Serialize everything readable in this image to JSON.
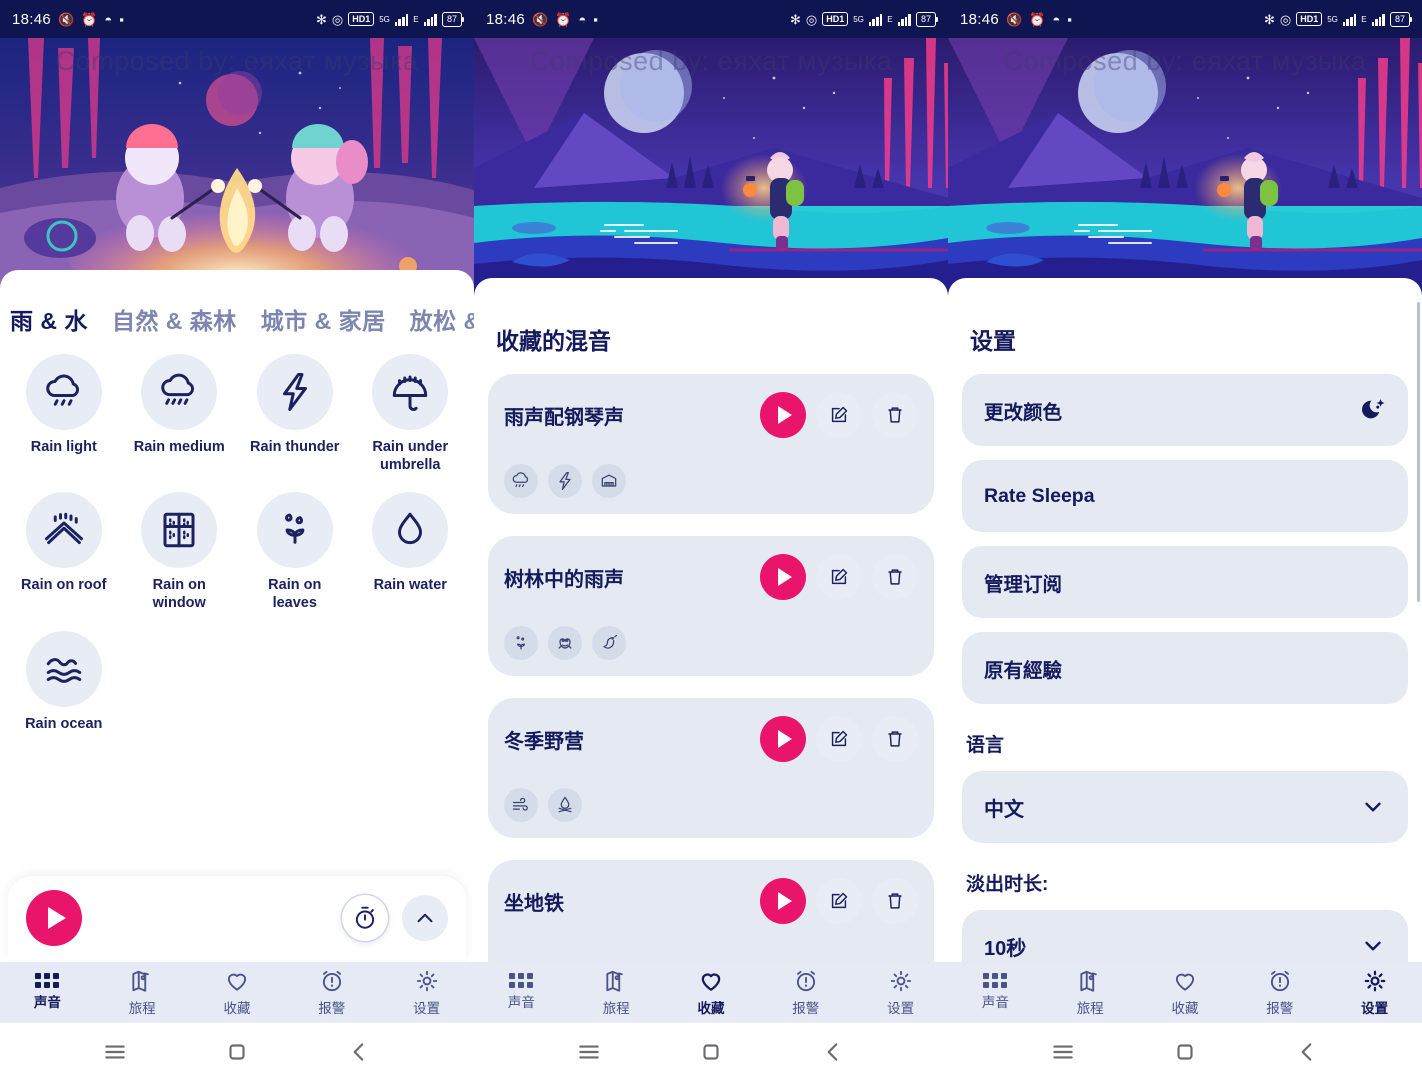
{
  "statusbar": {
    "time": "18:46",
    "left_icons": [
      "mute-icon",
      "alarm-icon",
      "screenshot-icon",
      "app-icon"
    ],
    "right_icons": [
      "bluetooth-icon",
      "dnd-icon",
      "hd-call-icon",
      "5g-signal-icon",
      "e-signal-icon"
    ],
    "hd_label": "HD1",
    "net_label": "5G",
    "net_label2": "E",
    "battery": "87"
  },
  "hero": {
    "watermark": "Composed by: еяхат музыка"
  },
  "screen1": {
    "tabs": [
      {
        "label": "雨 & 水",
        "active": true
      },
      {
        "label": "自然 & 森林",
        "active": false
      },
      {
        "label": "城市 & 家居",
        "active": false
      },
      {
        "label": "放松 &",
        "active": false
      }
    ],
    "sounds": [
      {
        "label": "Rain light",
        "icon": "rain-light-icon"
      },
      {
        "label": "Rain medium",
        "icon": "rain-medium-icon"
      },
      {
        "label": "Rain thunder",
        "icon": "thunder-icon"
      },
      {
        "label": "Rain under umbrella",
        "icon": "umbrella-icon"
      },
      {
        "label": "Rain on roof",
        "icon": "roof-icon"
      },
      {
        "label": "Rain on window",
        "icon": "window-icon"
      },
      {
        "label": "Rain on leaves",
        "icon": "leaves-icon"
      },
      {
        "label": "Rain water",
        "icon": "water-drop-icon"
      },
      {
        "label": "Rain ocean",
        "icon": "ocean-wave-icon"
      }
    ],
    "player": {
      "play_icon": "play-icon",
      "timer_icon": "stopwatch-icon",
      "expand_icon": "chevron-up-icon"
    }
  },
  "screen2": {
    "title": "收藏的混音",
    "mixes": [
      {
        "name": "雨声配钢琴声",
        "tags": [
          "rain-cloud-icon",
          "thunder-icon",
          "piano-icon"
        ]
      },
      {
        "name": "树林中的雨声",
        "tags": [
          "rain-leaves-icon",
          "frog-icon",
          "bird-icon"
        ]
      },
      {
        "name": "冬季野营",
        "tags": [
          "wind-icon",
          "campfire-icon"
        ]
      },
      {
        "name": "坐地铁",
        "tags": []
      }
    ],
    "actions": {
      "play": "play-icon",
      "edit": "edit-icon",
      "delete": "trash-icon"
    }
  },
  "screen3": {
    "title": "设置",
    "rows": [
      {
        "label": "更改颜色",
        "icon": "moon-stars-icon"
      },
      {
        "label": "Rate Sleepa",
        "icon": ""
      },
      {
        "label": "管理订阅",
        "icon": ""
      },
      {
        "label": "原有經驗",
        "icon": ""
      }
    ],
    "language_label": "语言",
    "language_value": "中文",
    "fade_label": "淡出时长:",
    "fade_value": "10秒",
    "chevron_icon": "chevron-down-icon"
  },
  "bottomnav": {
    "items": [
      {
        "label": "声音",
        "icon": "grid-dots-icon"
      },
      {
        "label": "旅程",
        "icon": "journey-map-icon"
      },
      {
        "label": "收藏",
        "icon": "heart-icon"
      },
      {
        "label": "报警",
        "icon": "alarm-clock-icon"
      },
      {
        "label": "设置",
        "icon": "gear-icon"
      }
    ],
    "active_index": [
      0,
      2,
      4
    ]
  },
  "sysnav": {
    "items": [
      "menu-icon",
      "home-icon",
      "back-icon"
    ]
  },
  "colors": {
    "accent": "#e8156b",
    "navy": "#141a5c",
    "card": "#e4e9f2",
    "navbar": "#e6eaf4",
    "statusbar": "#0e1550"
  }
}
